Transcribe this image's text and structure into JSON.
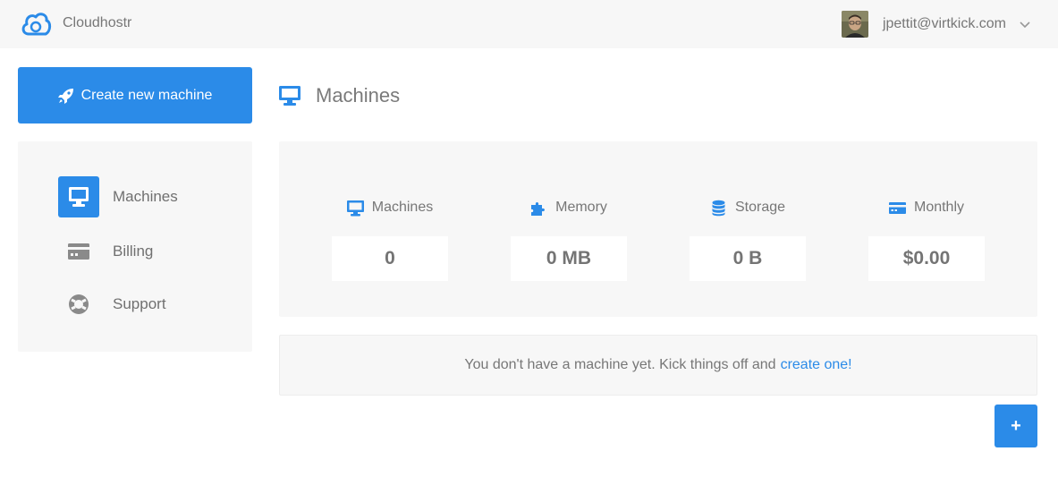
{
  "app": {
    "name": "Cloudhostr",
    "logo_icon": "cloud-logo-icon"
  },
  "user": {
    "email": "jpettit@virtkick.com",
    "avatar_icon": "user-avatar",
    "menu_icon": "chevron-down-icon"
  },
  "actions": {
    "create_label": "Create new machine",
    "create_icon": "rocket-icon",
    "add_icon_label": "+"
  },
  "sidebar": {
    "items": [
      {
        "label": "Machines",
        "icon": "monitor-icon",
        "active": true
      },
      {
        "label": "Billing",
        "icon": "credit-card-icon",
        "active": false
      },
      {
        "label": "Support",
        "icon": "lifebuoy-icon",
        "active": false
      }
    ]
  },
  "main": {
    "title": "Machines",
    "title_icon": "monitor-icon"
  },
  "stats": [
    {
      "label": "Machines",
      "value": "0",
      "icon": "monitor-icon"
    },
    {
      "label": "Memory",
      "value": "0 MB",
      "icon": "puzzle-icon"
    },
    {
      "label": "Storage",
      "value": "0 B",
      "icon": "database-icon"
    },
    {
      "label": "Monthly",
      "value": "$0.00",
      "icon": "credit-card-icon"
    }
  ],
  "empty_state": {
    "text": "You don't have a machine yet. Kick things off and",
    "link": "create one!"
  },
  "colors": {
    "accent": "#2b8be8",
    "panel": "#f7f7f7",
    "text": "#777777"
  }
}
